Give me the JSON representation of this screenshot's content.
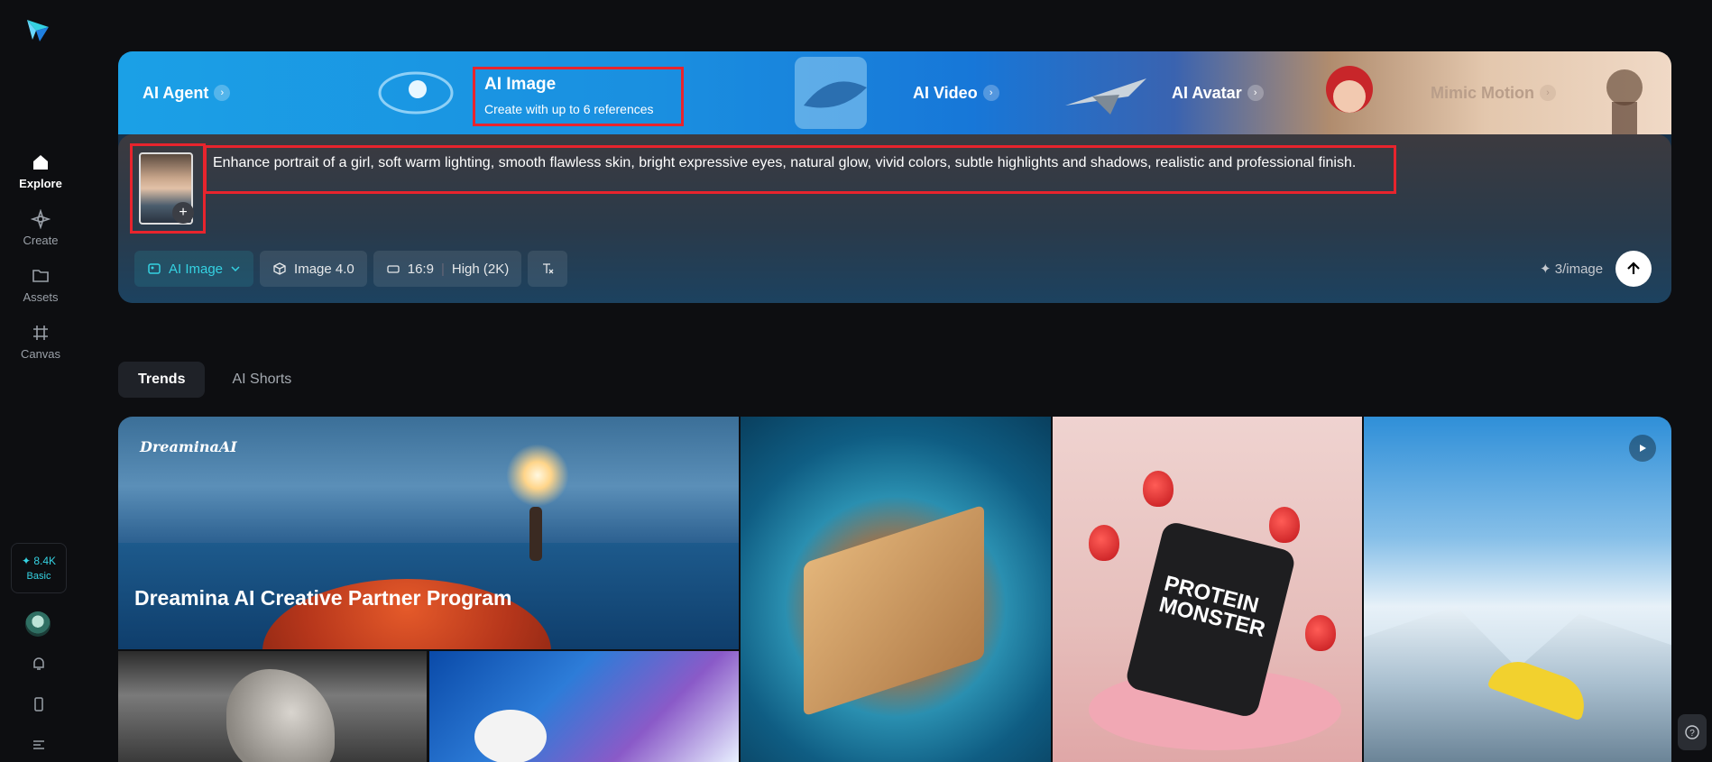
{
  "sidebar": {
    "nav": [
      {
        "label": "Explore",
        "icon": "home-icon",
        "active": true
      },
      {
        "label": "Create",
        "icon": "sparkle-icon",
        "active": false
      },
      {
        "label": "Assets",
        "icon": "folder-icon",
        "active": false
      },
      {
        "label": "Canvas",
        "icon": "canvas-icon",
        "active": false
      }
    ],
    "credits": {
      "value": "✦ 8.4K",
      "plan": "Basic"
    }
  },
  "hero": {
    "tabs": {
      "agent": "AI Agent",
      "image": "AI Image",
      "image_sub": "Create with up to 6 references",
      "video": "AI Video",
      "avatar": "AI Avatar",
      "mimic": "Mimic Motion"
    },
    "prompt": "Enhance portrait of a girl, soft warm lighting, smooth flawless skin, bright expressive eyes, natural glow, vivid colors, subtle highlights and shadows, realistic and professional finish.",
    "toolbar": {
      "mode": "AI Image",
      "model": "Image 4.0",
      "ratio": "16:9",
      "quality": "High (2K)"
    },
    "cost": "✦ 3/image"
  },
  "sections": {
    "tabs": [
      {
        "label": "Trends",
        "active": true
      },
      {
        "label": "AI Shorts",
        "active": false
      }
    ]
  },
  "gallery": {
    "banner_brand": "DreaminaAI",
    "banner_caption": "Dreamina AI Creative Partner Program",
    "product_text": "PROTEIN MONSTER"
  },
  "colors": {
    "accent": "#35d2e2",
    "highlight_border": "#e8242d",
    "background": "#0d0e11"
  }
}
